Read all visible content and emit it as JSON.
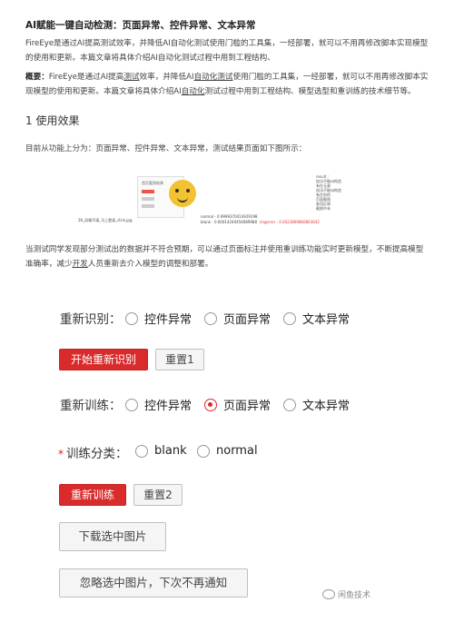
{
  "article": {
    "title": "AI赋能一键自动检测：页面异常、控件异常、文本异常",
    "intro": "FireEye是通过AI提高测试效率，并降低AI自动化测试使用门槛的工具集，一经部署，就可以不用再修改脚本实现模型的使用和更新。本篇文章将具体介绍AI自动化测试过程中用到工程结构、",
    "summary_label": "概要：",
    "summary_p1": "FireEye是通过AI提高",
    "summary_link1": "测试",
    "summary_p2": "效率，并降低AI",
    "summary_link2": "自动化测试",
    "summary_p3": "使用门槛的工具集，一经部署，就可以不用再修改脚本实现模型的使用和更新。本篇文章将具体介绍AI",
    "summary_link3": "自动化",
    "summary_p4": "测试过程中用到工程结构、模型选型和重训练的技术细节等。",
    "section_heading": "1 使用效果",
    "para_functions": "目前从功能上分为：页面异常、控件异常、文本异常，测试结果页面如下图所示：",
    "para_retrain_1": "当测试同学发现部分测试出的数据并不符合预期，可以通过页面标注并使用重训练功能实时更新模型，不断提高模型准确率，减少",
    "para_retrain_link": "开发",
    "para_retrain_2": "人员重新去介入模型的调整和部署。"
  },
  "figure": {
    "thumb_header": "首页看到结果",
    "filename": "26_风格不清_马上登录_click.jpg",
    "normal_text": "normal - 0.9999370414929198",
    "blank_text": "blank - 0.00014240456089988",
    "red_text": "imgerror - 0.0023809860803042",
    "right_title": "result :",
    "right_items": [
      "加法不能纠构造",
      "有在无意",
      "加法不能纠构造",
      "有在别的",
      "页面截图",
      "各项反馈",
      "截图中未"
    ]
  },
  "panel": {
    "reidentify_label": "重新识别：",
    "options_widget": "控件异常",
    "options_page": "页面异常",
    "options_text": "文本异常",
    "start_reidentify_button": "开始重新识别",
    "reset1_button": "重置1",
    "retrain_label": "重新训练：",
    "class_label": "训练分类：",
    "class_required_mark": "*",
    "class_blank": "blank",
    "class_normal": "normal",
    "retrain_button": "重新训练",
    "reset2_button": "重置2",
    "download_button": "下载选中图片",
    "ignore_button": "忽略选中图片，下次不再通知",
    "retrain_selected": "页面异常"
  },
  "footer": {
    "wechat_source": "闲鱼技术"
  },
  "colors": {
    "accent_red": "#d92b2b"
  }
}
